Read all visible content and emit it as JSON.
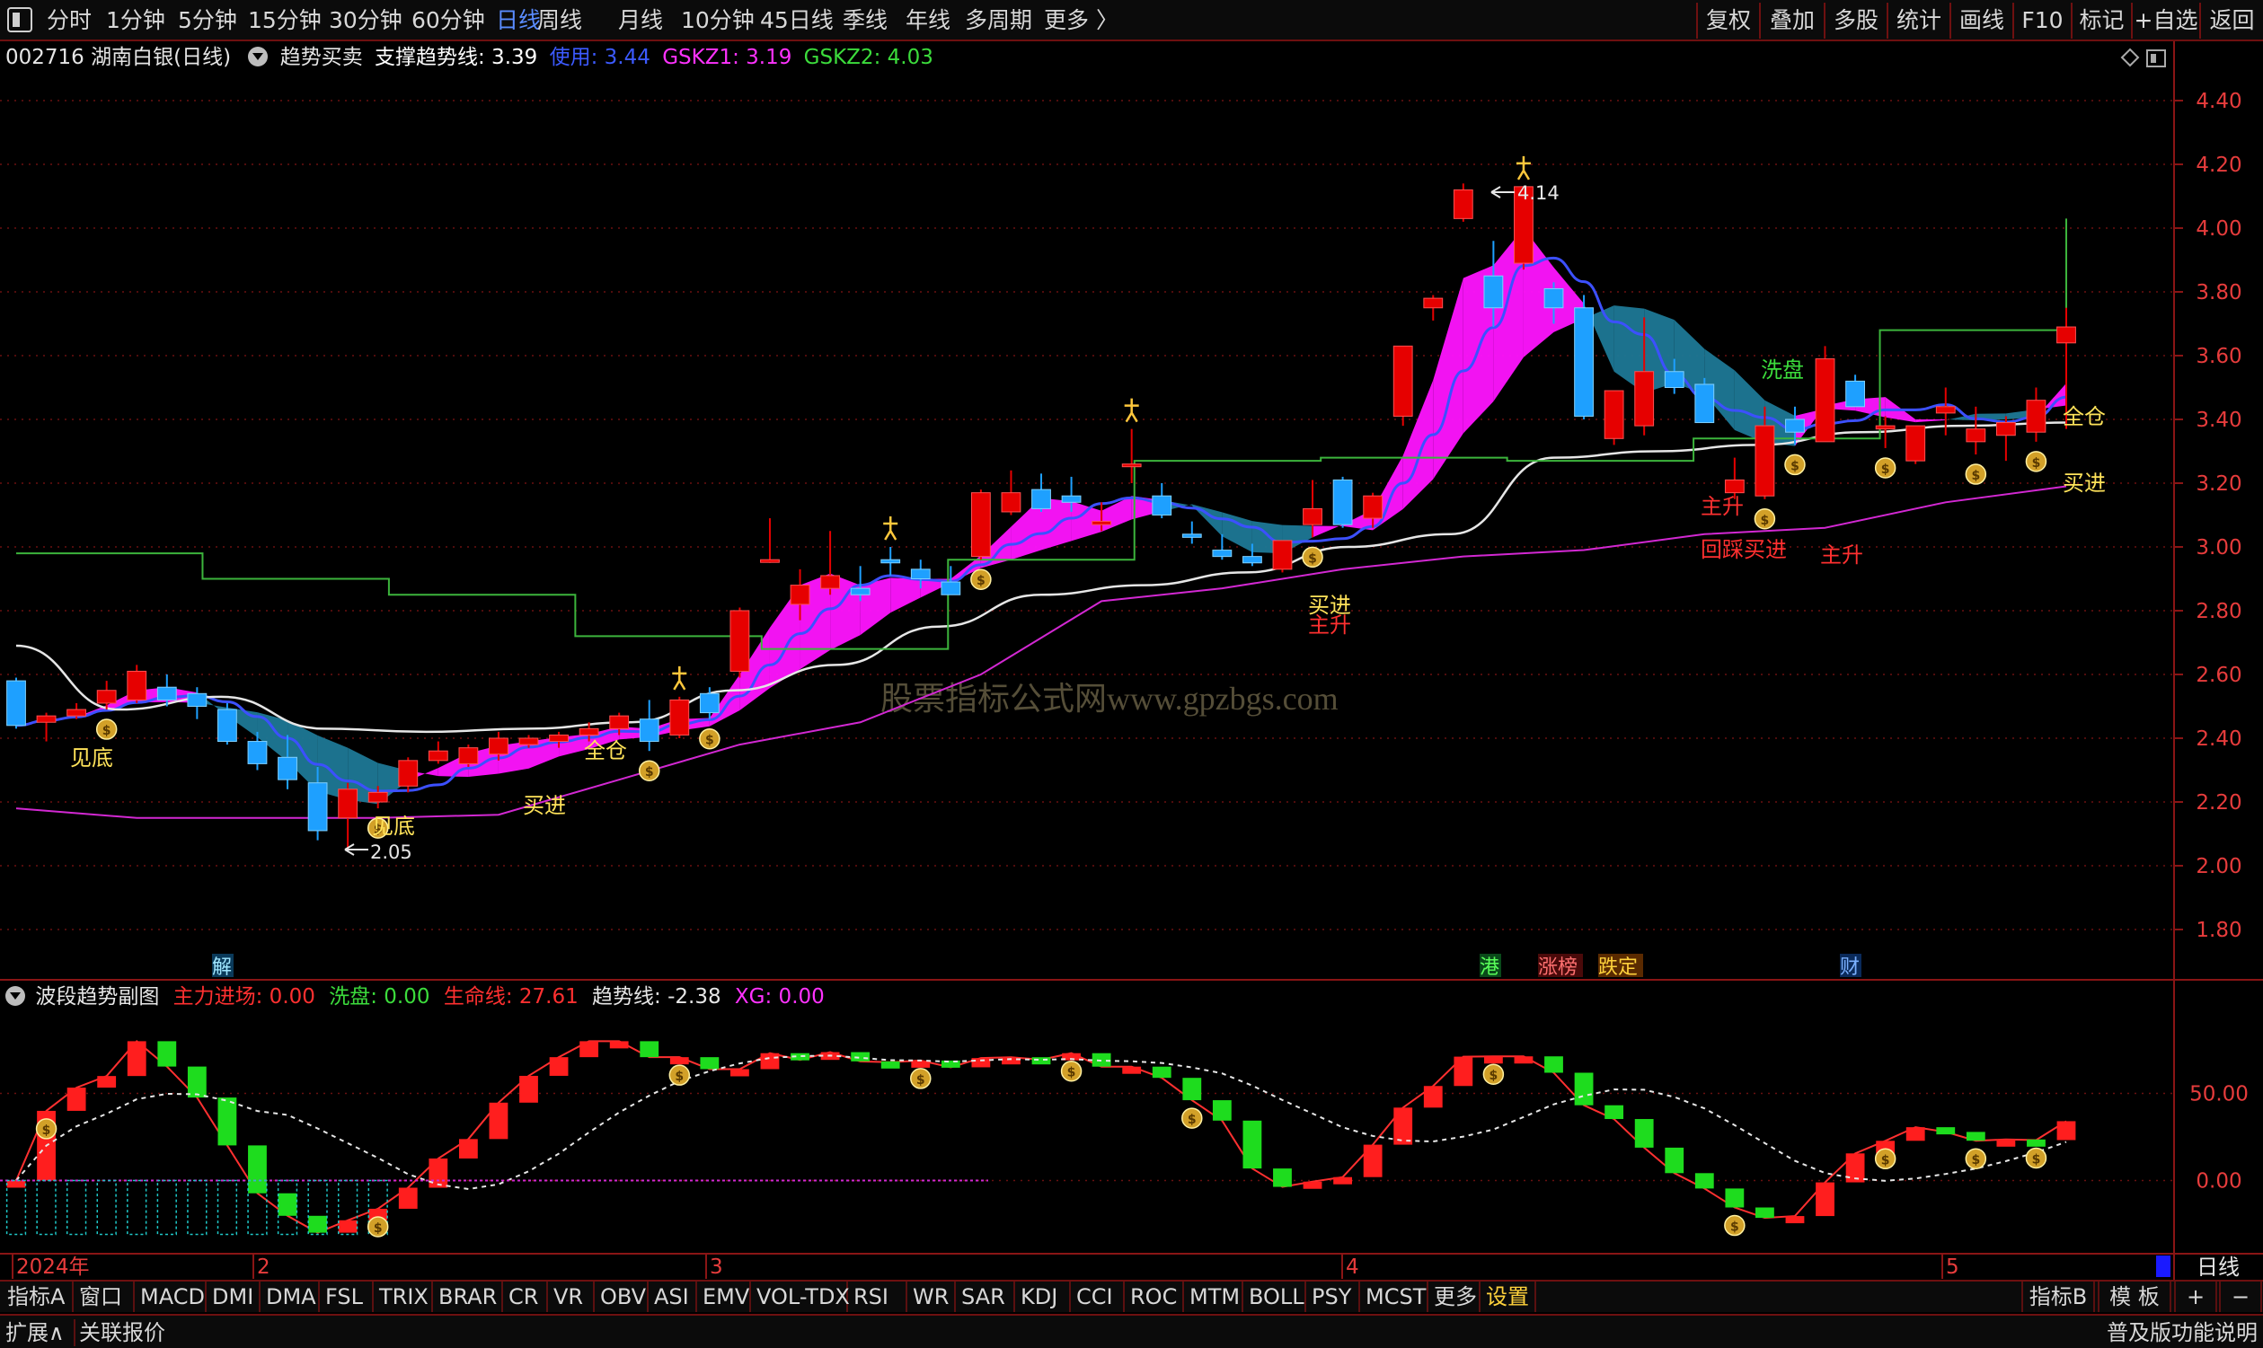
{
  "toolbar": {
    "periods": [
      "分时",
      "1分钟",
      "5分钟",
      "15分钟",
      "30分钟",
      "60分钟",
      "日线",
      "周线",
      "月线",
      "10分钟",
      "45日线",
      "季线",
      "年线",
      "多周期",
      "更多 〉"
    ],
    "active_period": "日线",
    "right_buttons": [
      "复权",
      "叠加",
      "多股",
      "统计",
      "画线",
      "F10",
      "标记",
      "+自选",
      "返回"
    ]
  },
  "info": {
    "stock": "002716 湖南白银(日线)",
    "indicator": "趋势买卖",
    "support_label": "支撑趋势线: 3.39",
    "use_label": "使用: 3.44",
    "gskz1_label": "GSKZ1: 3.19",
    "gskz2_label": "GSKZ2: 4.03"
  },
  "sub_info": {
    "indicator": "波段趋势副图",
    "main_label": "主力进场: 0.00",
    "wash_label": "洗盘: 0.00",
    "life_label": "生命线: 27.61",
    "trend_label": "趋势线: -2.38",
    "xg_label": "XG: 0.00"
  },
  "main_axis": [
    "4.40",
    "4.20",
    "4.00",
    "3.80",
    "3.60",
    "3.40",
    "3.20",
    "3.00",
    "2.80",
    "2.60",
    "2.40",
    "2.20",
    "2.00",
    "1.80"
  ],
  "sub_axis": [
    "50.00",
    "0.00"
  ],
  "date_labels": [
    "2024年",
    "2",
    "3",
    "4",
    "5"
  ],
  "annotations": {
    "jiandi": "见底",
    "jiandi2": "见底",
    "quancang1": "全仓",
    "quancang2": "全仓",
    "mairu1": "买进",
    "mairu2": "买进",
    "mairu3": "买进",
    "zhusheng1": "主升",
    "zhusheng2": "主升",
    "zhusheng3": "主升",
    "xipan": "洗盘",
    "huicai": "回踩买进",
    "high_marker": "4.14",
    "low_marker": "2.05",
    "event_jie": "解",
    "event_gang": "港",
    "event_zhangbang": "涨榜",
    "event_diedong": "跌定",
    "event_cai": "财",
    "watermark": "股票指标公式网www.gpzbgs.com"
  },
  "colors": {
    "up": "#e60000",
    "down": "#1ea0ff",
    "magenta": "#ff14ff",
    "teal": "#1e7896",
    "support": "#9fe",
    "accent_red": "#6e1010"
  },
  "tabs": [
    "指标A",
    "窗口",
    "MACD",
    "DMI",
    "DMA",
    "FSL",
    "TRIX",
    "BRAR",
    "CR",
    "VR",
    "OBV",
    "ASI",
    "EMV",
    "VOL-TDX",
    "RSI",
    "WR",
    "SAR",
    "KDJ",
    "CCI",
    "ROC",
    "MTM",
    "BOLL",
    "PSY",
    "MCST",
    "更多",
    "设置"
  ],
  "tabs_right": [
    "指标B",
    "模 板",
    "+",
    "−"
  ],
  "status": {
    "left1": "扩展∧",
    "left2": "关联报价",
    "right": "普及版功能说明",
    "period_label": "日线"
  },
  "chart_data": {
    "type": "candlestick",
    "title": "002716 湖南白银(日线)",
    "ylim": [
      1.8,
      4.4
    ],
    "x": [
      "2024-01",
      "2024-02",
      "2024-03",
      "2024-04",
      "2024-05"
    ],
    "ohlc": [
      [
        2.58,
        2.59,
        2.43,
        2.44
      ],
      [
        2.45,
        2.48,
        2.39,
        2.47
      ],
      [
        2.47,
        2.51,
        2.46,
        2.49
      ],
      [
        2.51,
        2.58,
        2.49,
        2.55
      ],
      [
        2.52,
        2.63,
        2.51,
        2.61
      ],
      [
        2.56,
        2.6,
        2.5,
        2.52
      ],
      [
        2.54,
        2.56,
        2.46,
        2.5
      ],
      [
        2.49,
        2.51,
        2.38,
        2.39
      ],
      [
        2.39,
        2.42,
        2.3,
        2.32
      ],
      [
        2.34,
        2.41,
        2.24,
        2.27
      ],
      [
        2.26,
        2.31,
        2.08,
        2.11
      ],
      [
        2.15,
        2.26,
        2.05,
        2.24
      ],
      [
        2.2,
        2.25,
        2.18,
        2.23
      ],
      [
        2.25,
        2.34,
        2.23,
        2.33
      ],
      [
        2.33,
        2.39,
        2.32,
        2.36
      ],
      [
        2.32,
        2.38,
        2.31,
        2.37
      ],
      [
        2.35,
        2.42,
        2.33,
        2.4
      ],
      [
        2.38,
        2.41,
        2.37,
        2.4
      ],
      [
        2.39,
        2.42,
        2.37,
        2.41
      ],
      [
        2.41,
        2.45,
        2.39,
        2.43
      ],
      [
        2.43,
        2.48,
        2.41,
        2.47
      ],
      [
        2.46,
        2.52,
        2.36,
        2.39
      ],
      [
        2.41,
        2.53,
        2.4,
        2.52
      ],
      [
        2.54,
        2.56,
        2.46,
        2.48
      ],
      [
        2.61,
        2.81,
        2.59,
        2.8
      ],
      [
        2.96,
        3.09,
        2.95,
        2.96
      ],
      [
        2.82,
        2.93,
        2.77,
        2.88
      ],
      [
        2.87,
        3.05,
        2.85,
        2.91
      ],
      [
        2.87,
        2.94,
        2.83,
        2.85
      ],
      [
        2.96,
        3.0,
        2.91,
        2.95
      ],
      [
        2.93,
        2.96,
        2.87,
        2.9
      ],
      [
        2.89,
        2.94,
        2.85,
        2.85
      ],
      [
        2.97,
        3.18,
        2.96,
        3.17
      ],
      [
        3.11,
        3.24,
        3.1,
        3.17
      ],
      [
        3.18,
        3.23,
        3.11,
        3.12
      ],
      [
        3.16,
        3.22,
        3.11,
        3.14
      ],
      [
        3.07,
        3.14,
        3.05,
        3.08
      ],
      [
        3.26,
        3.37,
        3.2,
        3.26
      ],
      [
        3.16,
        3.2,
        3.09,
        3.1
      ],
      [
        3.04,
        3.08,
        3.01,
        3.03
      ],
      [
        2.99,
        3.04,
        2.96,
        2.97
      ],
      [
        2.97,
        3.01,
        2.94,
        2.95
      ],
      [
        2.93,
        3.02,
        2.92,
        3.02
      ],
      [
        3.07,
        3.21,
        3.03,
        3.12
      ],
      [
        3.21,
        3.22,
        3.06,
        3.07
      ],
      [
        3.09,
        3.17,
        3.06,
        3.16
      ],
      [
        3.41,
        3.63,
        3.38,
        3.63
      ],
      [
        3.75,
        3.79,
        3.71,
        3.78
      ],
      [
        4.03,
        4.14,
        4.02,
        4.12
      ],
      [
        3.85,
        3.96,
        3.69,
        3.75
      ],
      [
        3.89,
        4.13,
        3.87,
        4.13
      ],
      [
        3.81,
        3.83,
        3.7,
        3.75
      ],
      [
        3.75,
        3.79,
        3.4,
        3.41
      ],
      [
        3.34,
        3.49,
        3.32,
        3.49
      ],
      [
        3.38,
        3.72,
        3.35,
        3.55
      ],
      [
        3.55,
        3.59,
        3.48,
        3.5
      ],
      [
        3.51,
        3.53,
        3.39,
        3.39
      ],
      [
        3.17,
        3.28,
        3.15,
        3.21
      ],
      [
        3.16,
        3.44,
        3.15,
        3.38
      ],
      [
        3.4,
        3.44,
        3.32,
        3.36
      ],
      [
        3.33,
        3.63,
        3.33,
        3.59
      ],
      [
        3.52,
        3.54,
        3.44,
        3.44
      ],
      [
        3.37,
        3.41,
        3.31,
        3.38
      ],
      [
        3.27,
        3.38,
        3.26,
        3.38
      ],
      [
        3.42,
        3.5,
        3.35,
        3.44
      ],
      [
        3.33,
        3.44,
        3.29,
        3.37
      ],
      [
        3.35,
        3.41,
        3.27,
        3.39
      ],
      [
        3.36,
        3.5,
        3.33,
        3.46
      ],
      [
        3.64,
        3.75,
        3.37,
        3.69
      ]
    ],
    "series": [
      {
        "name": "支撑趋势线",
        "values": [
          2.69,
          2.49,
          2.53,
          2.43,
          2.42,
          2.43,
          2.45,
          2.55,
          2.63,
          2.75,
          2.85,
          2.88,
          2.92,
          3.0,
          3.04,
          3.28,
          3.3,
          3.32,
          3.36,
          3.38,
          3.39
        ]
      },
      {
        "name": "GSKZ1",
        "values": [
          2.18,
          2.15,
          2.15,
          2.15,
          2.16,
          2.27,
          2.38,
          2.45,
          2.6,
          2.83,
          2.87,
          2.93,
          2.97,
          2.99,
          3.04,
          3.06,
          3.14,
          3.19
        ]
      },
      {
        "name": "GSKZ2",
        "values": [
          2.98,
          2.9,
          2.85,
          2.72,
          2.68,
          2.96,
          3.27,
          3.28,
          3.27,
          3.34,
          3.68,
          4.03
        ]
      }
    ],
    "sub_chart": {
      "ylim": [
        -40,
        90
      ],
      "ticks": [
        50,
        0
      ],
      "xlabel": "",
      "ylabel": ""
    }
  }
}
